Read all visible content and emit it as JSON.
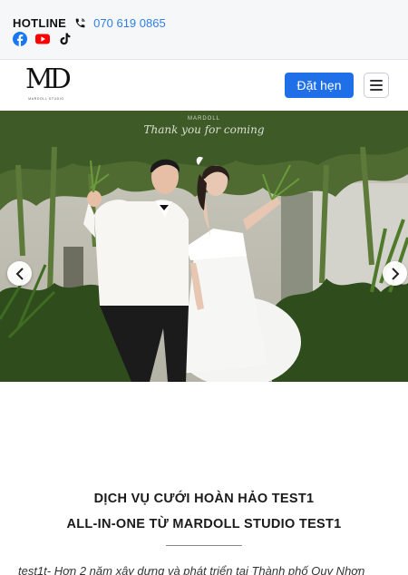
{
  "topbar": {
    "hotline_label": "HOTLINE",
    "hotline_number": "070 619 0865",
    "phone_icon": "phone-icon",
    "social": [
      {
        "name": "facebook-icon",
        "color": "#1877f2"
      },
      {
        "name": "youtube-icon",
        "color": "#ff0000"
      },
      {
        "name": "tiktok-icon",
        "color": "#000000"
      }
    ]
  },
  "navbar": {
    "logo_mark": "MD",
    "logo_sub": "MARDOLL STUDIO",
    "book_label": "Đặt hẹn",
    "menu_icon": "hamburger-menu-icon"
  },
  "hero": {
    "watermark_brand": "MARDOLL",
    "watermark_text": "Thank you for coming",
    "prev_icon": "chevron-left-icon",
    "next_icon": "chevron-right-icon"
  },
  "section": {
    "title_line1": "DỊCH VỤ CƯỚI HOÀN HẢO TEST1",
    "title_line2": "ALL-IN-ONE TỪ MARDOLL STUDIO TEST1",
    "intro": "test1t- Hơn 2 năm xây dựng và phát triển tại Thành phố Quy Nhơn"
  },
  "colors": {
    "accent": "#1f6fe8",
    "link": "#2f7fe6",
    "topbar_bg": "#f6f7f9"
  }
}
